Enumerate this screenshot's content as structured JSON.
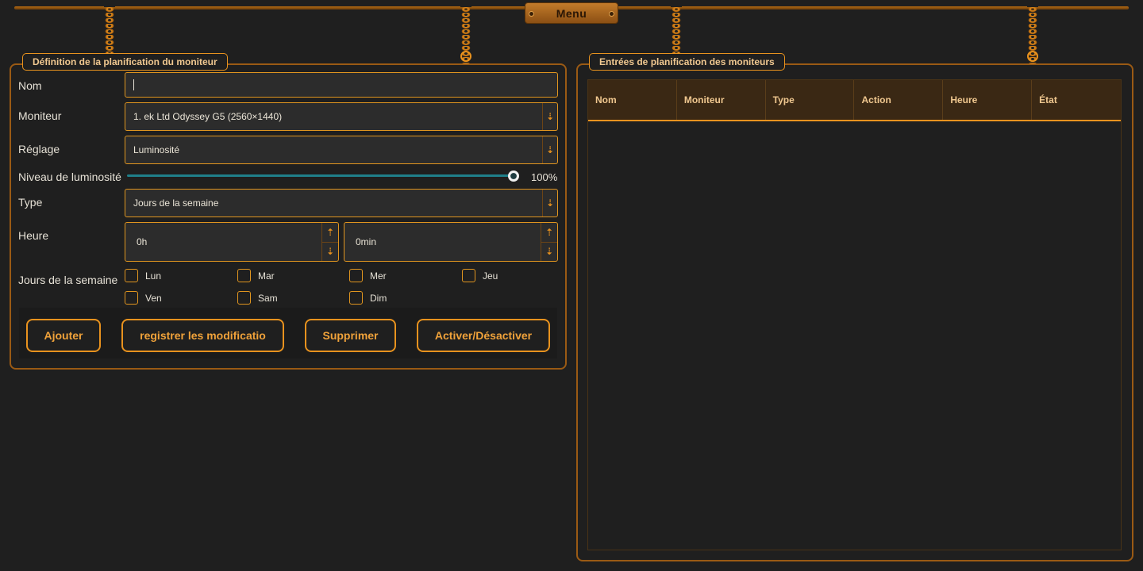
{
  "menu": {
    "label": "Menu"
  },
  "left_panel": {
    "title": "Définition de la planification du moniteur",
    "name": {
      "label": "Nom",
      "value": ""
    },
    "monitor": {
      "label": "Moniteur",
      "value": "1. ek Ltd Odyssey G5 (2560×1440)"
    },
    "setting": {
      "label": "Réglage",
      "value": "Luminosité"
    },
    "brightness": {
      "label": "Niveau de luminosité",
      "value_text": "100%",
      "value": 100
    },
    "type": {
      "label": "Type",
      "value": "Jours de la semaine"
    },
    "time": {
      "label": "Heure",
      "hours": "0h",
      "minutes": "0min"
    },
    "weekdays": {
      "label": "Jours de la semaine",
      "days": [
        "Lun",
        "Mar",
        "Mer",
        "Jeu",
        "Ven",
        "Sam",
        "Dim"
      ]
    },
    "buttons": {
      "add": "Ajouter",
      "save": "registrer les modificatio",
      "delete": "Supprimer",
      "toggle": "Activer/Désactiver"
    }
  },
  "right_panel": {
    "title": "Entrées de planification des moniteurs",
    "columns": [
      "Nom",
      "Moniteur",
      "Type",
      "Action",
      "Heure",
      "État"
    ]
  },
  "icons": {
    "dropdown": "⇣",
    "spin_up": "⇡",
    "spin_down": "⇣"
  },
  "colors": {
    "accent": "#e8921e",
    "background": "#1f1f1f",
    "slider_track": "#1f7f8a"
  }
}
